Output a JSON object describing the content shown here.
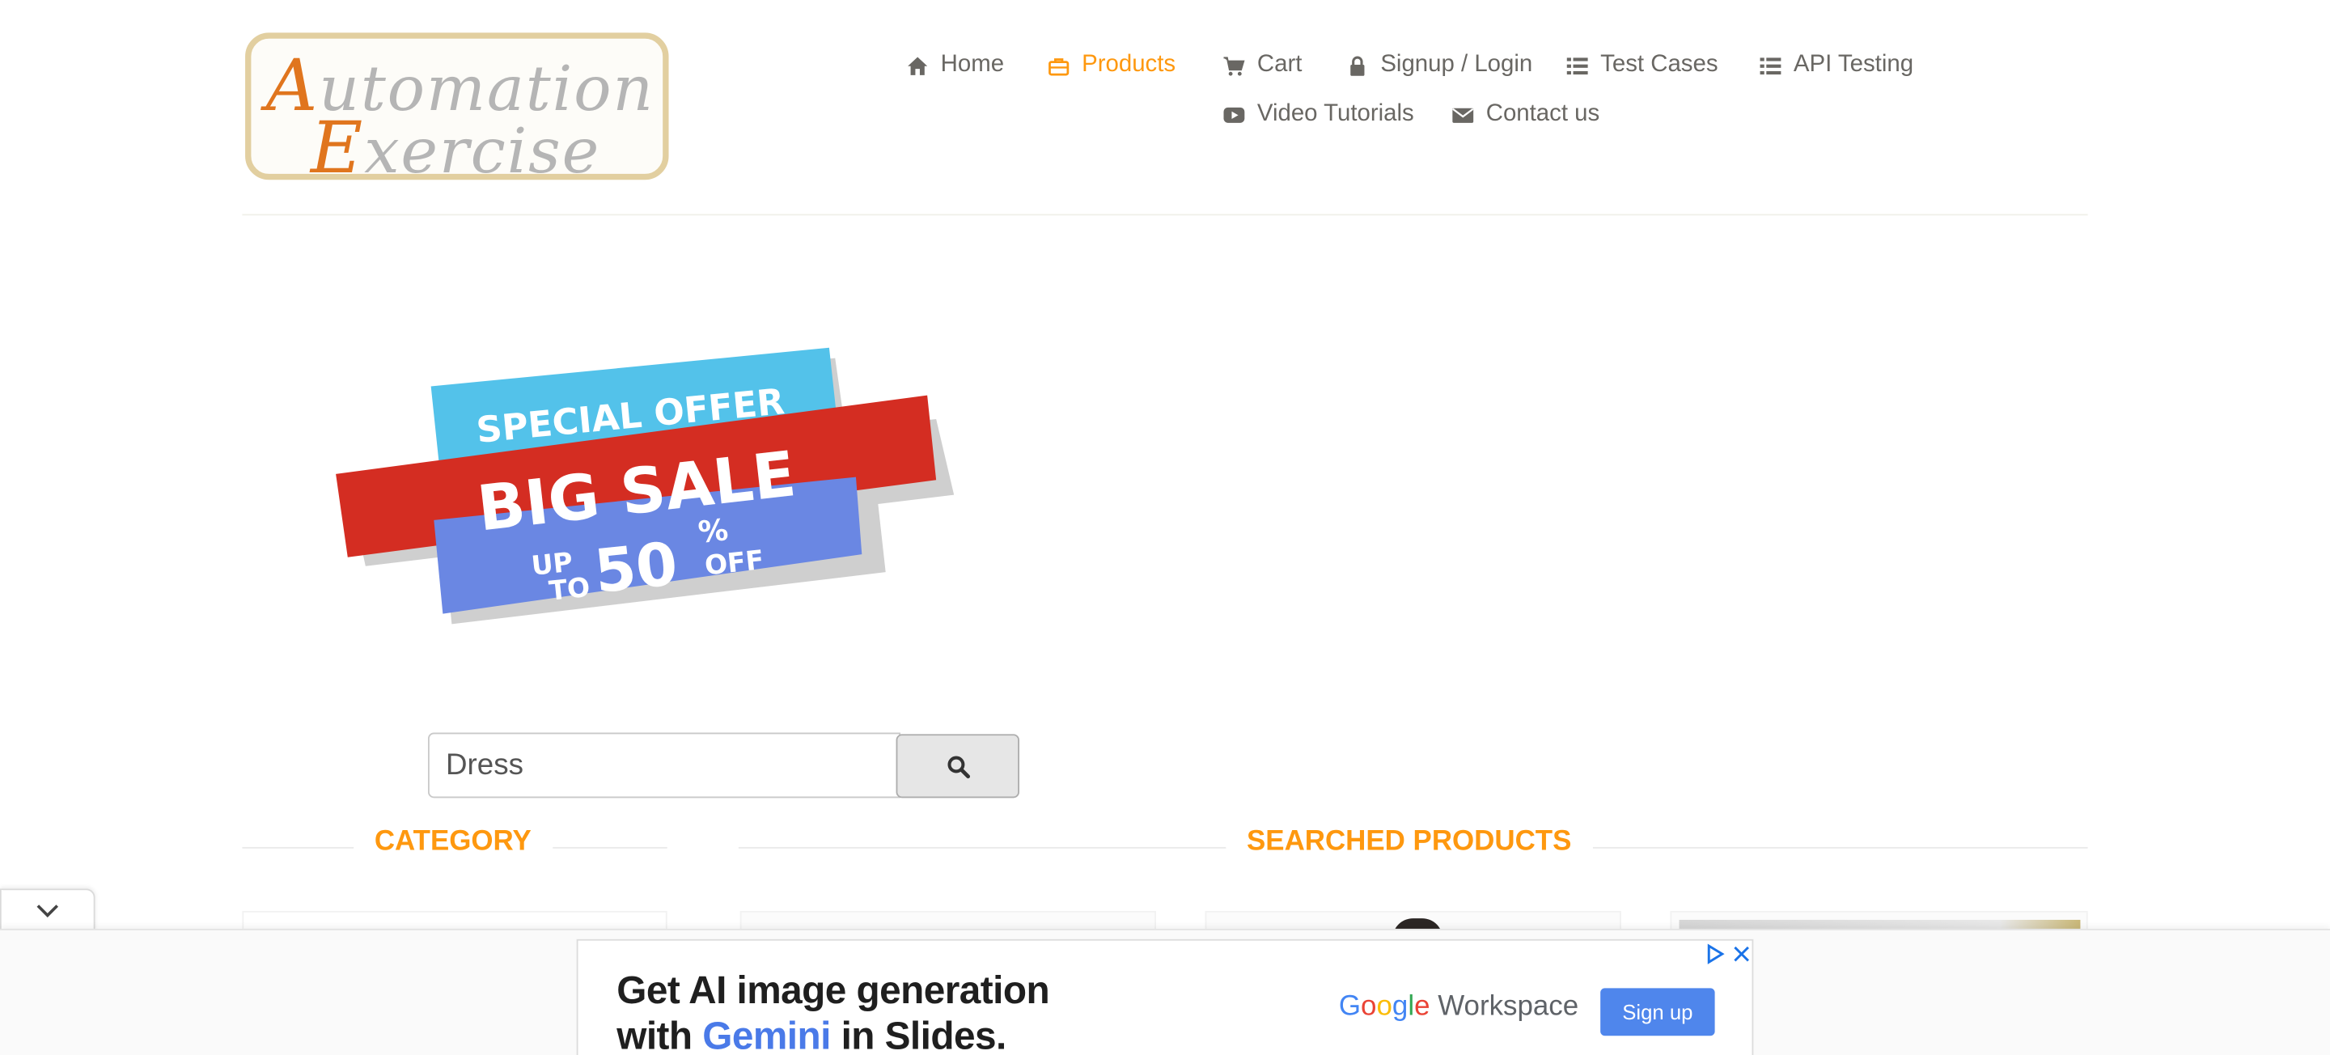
{
  "site": {
    "logo_line1_cap": "A",
    "logo_line1_rest": "utomation",
    "logo_line2_cap": "E",
    "logo_line2_rest": "xercise"
  },
  "nav": {
    "items": [
      {
        "label": "Home",
        "icon": "home-icon"
      },
      {
        "label": "Products",
        "icon": "briefcase-icon",
        "active": true
      },
      {
        "label": "Cart",
        "icon": "cart-icon"
      },
      {
        "label": "Signup / Login",
        "icon": "lock-icon"
      },
      {
        "label": "Test Cases",
        "icon": "list-icon"
      },
      {
        "label": "API Testing",
        "icon": "list-icon"
      },
      {
        "label": "Video Tutorials",
        "icon": "youtube-play-icon"
      },
      {
        "label": "Contact us",
        "icon": "envelope-icon"
      }
    ]
  },
  "banner": {
    "line1": "SPECIAL OFFER",
    "line2": "BIG SALE",
    "line3_a": "UP",
    "line3_b": "TO",
    "line3_num": "50",
    "line3_pct": "%",
    "line3_off": "OFF"
  },
  "search": {
    "value": "Dress",
    "button_icon": "search-icon"
  },
  "sections": {
    "category_title": "CATEGORY",
    "products_title": "SEARCHED PRODUCTS"
  },
  "ad": {
    "headline_line1": "Get AI image generation",
    "headline_pre": "with ",
    "headline_brand": "Gemini",
    "headline_post": " in Slides.",
    "brand_g1": "G",
    "brand_g2": "o",
    "brand_g3": "o",
    "brand_g4": "g",
    "brand_g5": "l",
    "brand_g6": "e",
    "brand_product": " Workspace",
    "cta": "Sign up"
  },
  "colors": {
    "accent": "#fe980f",
    "text": "#696763",
    "ad_cta": "#4f86ec"
  }
}
